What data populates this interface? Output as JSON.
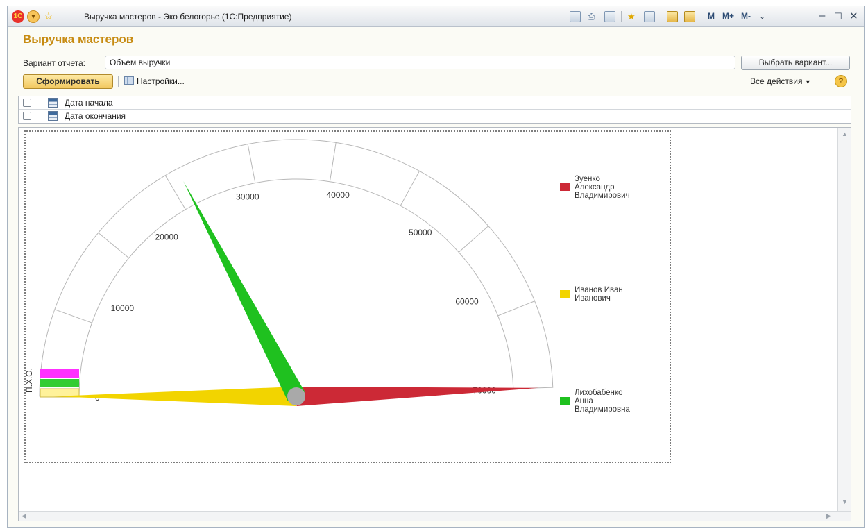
{
  "window": {
    "title": "Выручка мастеров - Эко белогорье  (1С:Предприятие)",
    "toolbar_text": {
      "m": "M",
      "m_plus": "M+",
      "m_minus": "M-"
    },
    "icons": [
      "1c-logo-icon",
      "main-menu-icon",
      "favorite-star-icon",
      "save-icon",
      "print-icon",
      "preview-icon",
      "add-favorite-icon",
      "favorites-icon",
      "calculator-icon",
      "calendar-icon",
      "minimize-icon",
      "close-icon"
    ]
  },
  "report": {
    "title": "Выручка мастеров",
    "variant_label": "Вариант отчета:",
    "variant_value": "Объем выручки",
    "choose_variant_button": "Выбрать вариант...",
    "generate_button": "Сформировать",
    "settings_button": "Настройки...",
    "all_actions": "Все действия",
    "help_label": "?"
  },
  "params": [
    {
      "label": "Дата начала",
      "checked": false
    },
    {
      "label": "Дата окончания",
      "checked": false
    }
  ],
  "chart_data": {
    "type": "gauge",
    "title": "",
    "range": [
      0,
      70000
    ],
    "tick_labels": [
      "0",
      "10000",
      "20000",
      "30000",
      "40000",
      "50000",
      "60000",
      "70000"
    ],
    "band_label": "П.Х.О.",
    "series": [
      {
        "name": "Зуенко Александр Владимирович",
        "value": 70000,
        "color": "#cc2936"
      },
      {
        "name": "Иванов Иван Иванович",
        "value": 0,
        "color": "#f2d400"
      },
      {
        "name": "Лихобабенко Анна Владимировна",
        "value": 24500,
        "color": "#1fc11f"
      }
    ],
    "legend_position": "right",
    "band_colors": [
      "#ff30ff",
      "#33cc33",
      "#fff29a"
    ]
  }
}
